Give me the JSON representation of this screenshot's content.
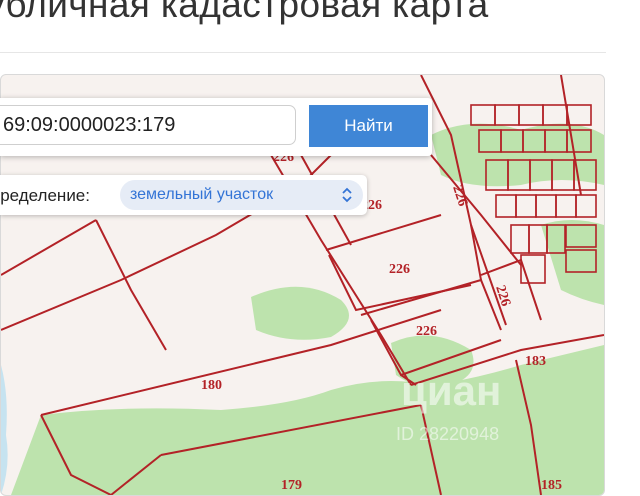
{
  "header": {
    "title": "убличная кадастровая карта"
  },
  "search": {
    "value": "69:09:0000023:179",
    "button_label": "Найти"
  },
  "definition": {
    "label": "пределение:",
    "selected": "земельный участок"
  },
  "map": {
    "parcel_labels": [
      "226",
      "226",
      "226",
      "226",
      "226",
      "226",
      "183",
      "180",
      "179",
      "185"
    ],
    "watermark": "циан",
    "watermark_id": "ID 28220948",
    "colors": {
      "boundary": "#b32227",
      "land": "#f7f2ef",
      "forest": "#bde3ad",
      "water": "#c6e3f0"
    }
  }
}
